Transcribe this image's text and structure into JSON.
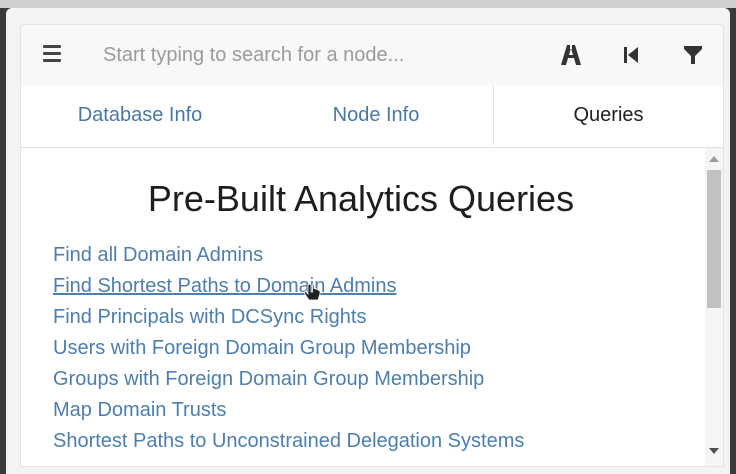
{
  "search": {
    "placeholder": "Start typing to search for a node..."
  },
  "toolbar": {
    "icons": [
      "menu-icon",
      "pathfinding-road-icon",
      "back-icon",
      "filter-icon"
    ]
  },
  "tabs": [
    {
      "label": "Database Info",
      "active": false
    },
    {
      "label": "Node Info",
      "active": false
    },
    {
      "label": "Queries",
      "active": true
    }
  ],
  "queries": {
    "title": "Pre-Built Analytics Queries",
    "items": [
      {
        "label": "Find all Domain Admins"
      },
      {
        "label": "Find Shortest Paths to Domain Admins"
      },
      {
        "label": "Find Principals with DCSync Rights"
      },
      {
        "label": "Users with Foreign Domain Group Membership"
      },
      {
        "label": "Groups with Foreign Domain Group Membership"
      },
      {
        "label": "Map Domain Trusts"
      },
      {
        "label": "Shortest Paths to Unconstrained Delegation Systems"
      }
    ]
  },
  "colors": {
    "link": "#4e7eab",
    "tab_text": "#4a78a5",
    "title": "#1e1e1e"
  }
}
